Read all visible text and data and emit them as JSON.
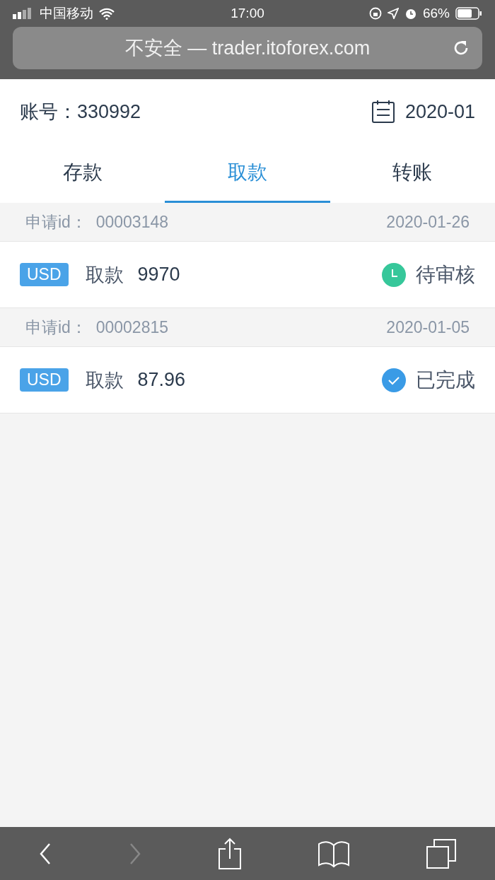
{
  "status_bar": {
    "carrier": "中国移动",
    "time": "17:00",
    "battery": "66%"
  },
  "address_bar": {
    "text": "不安全 — trader.itoforex.com"
  },
  "account": {
    "label": "账号：",
    "number": "330992",
    "month": "2020-01"
  },
  "tabs": [
    {
      "label": "存款",
      "selected": false
    },
    {
      "label": "取款",
      "selected": true
    },
    {
      "label": "转账",
      "selected": false
    }
  ],
  "records": [
    {
      "id_label": "申请id：",
      "id": "00003148",
      "date": "2020-01-26",
      "currency": "USD",
      "type": "取款",
      "amount": "9970",
      "status": "待审核",
      "kind": "pending"
    },
    {
      "id_label": "申请id：",
      "id": "00002815",
      "date": "2020-01-05",
      "currency": "USD",
      "type": "取款",
      "amount": "87.96",
      "status": "已完成",
      "kind": "done"
    }
  ],
  "toolbar": {
    "back_disabled": false,
    "forward_disabled": true
  }
}
